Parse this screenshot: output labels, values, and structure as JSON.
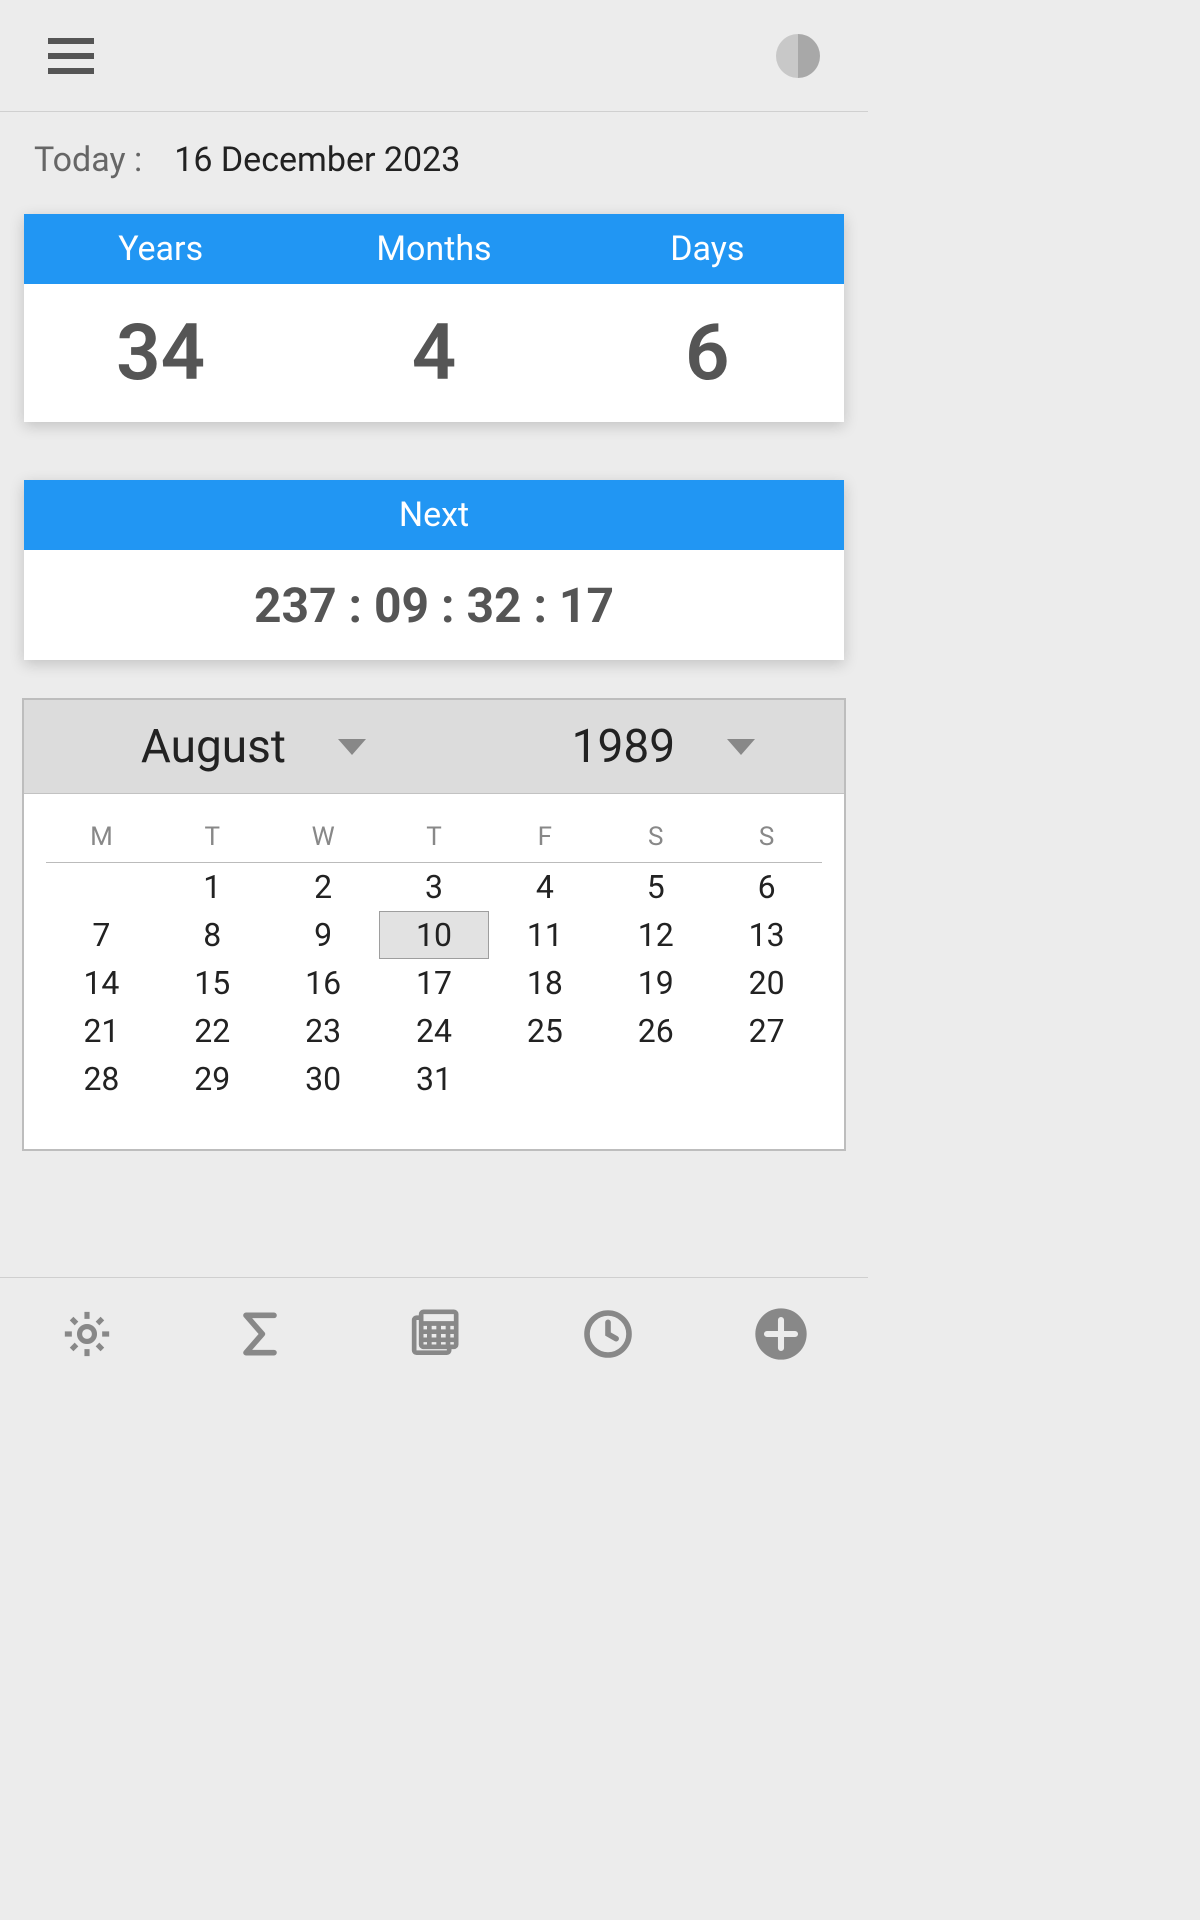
{
  "today": {
    "label": "Today :",
    "value": "16 December 2023"
  },
  "age_card": {
    "headers": {
      "years": "Years",
      "months": "Months",
      "days": "Days"
    },
    "values": {
      "years": "34",
      "months": "4",
      "days": "6"
    }
  },
  "next_card": {
    "header": "Next",
    "value": "237 : 09 : 32 : 17"
  },
  "calendar": {
    "month": "August",
    "year": "1989",
    "weekdays": [
      "M",
      "T",
      "W",
      "T",
      "F",
      "S",
      "S"
    ],
    "first_weekday_index": 1,
    "days_in_month": 31,
    "selected_day": 10
  },
  "icons": {
    "menu": "menu-icon",
    "theme": "theme-toggle-icon",
    "bottom": [
      "gear-icon",
      "sigma-icon",
      "calendar-icon",
      "clock-icon",
      "plus-icon"
    ]
  }
}
